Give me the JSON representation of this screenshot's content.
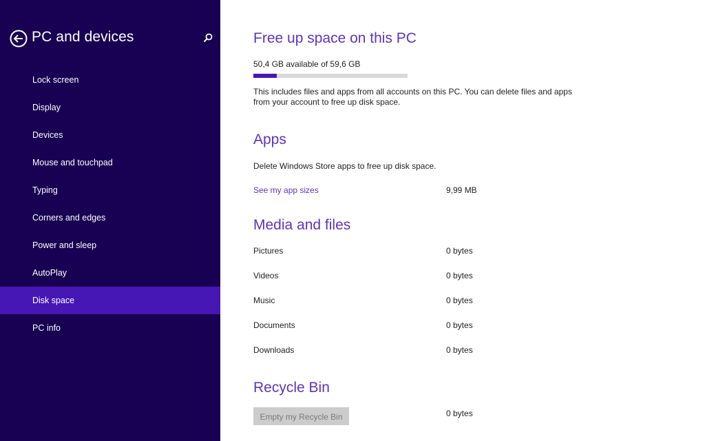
{
  "sidebar": {
    "title": "PC and devices",
    "items": [
      {
        "label": "Lock screen"
      },
      {
        "label": "Display"
      },
      {
        "label": "Devices"
      },
      {
        "label": "Mouse and touchpad"
      },
      {
        "label": "Typing"
      },
      {
        "label": "Corners and edges"
      },
      {
        "label": "Power and sleep"
      },
      {
        "label": "AutoPlay"
      },
      {
        "label": "Disk space",
        "selected": true
      },
      {
        "label": "PC info"
      }
    ]
  },
  "free_space": {
    "title": "Free up space on this PC",
    "available": "50,4 GB available of 59,6 GB",
    "used_fraction": 0.154,
    "description": "This includes files and apps from all accounts on this PC. You can delete files and apps from your account to free up disk space."
  },
  "apps": {
    "title": "Apps",
    "description": "Delete Windows Store apps to free up disk space.",
    "link": "See my app sizes",
    "size": "9,99 MB"
  },
  "media": {
    "title": "Media and files",
    "rows": [
      {
        "label": "Pictures",
        "value": "0 bytes"
      },
      {
        "label": "Videos",
        "value": "0 bytes"
      },
      {
        "label": "Music",
        "value": "0 bytes"
      },
      {
        "label": "Documents",
        "value": "0 bytes"
      },
      {
        "label": "Downloads",
        "value": "0 bytes"
      }
    ]
  },
  "recycle_bin": {
    "title": "Recycle Bin",
    "button": "Empty my Recycle Bin",
    "value": "0 bytes"
  },
  "colors": {
    "sidebar_bg": "#180052",
    "selected_bg": "#4617b4",
    "accent": "#5d34b8"
  },
  "icons": {
    "back": "back-arrow-icon",
    "search": "search-icon"
  }
}
